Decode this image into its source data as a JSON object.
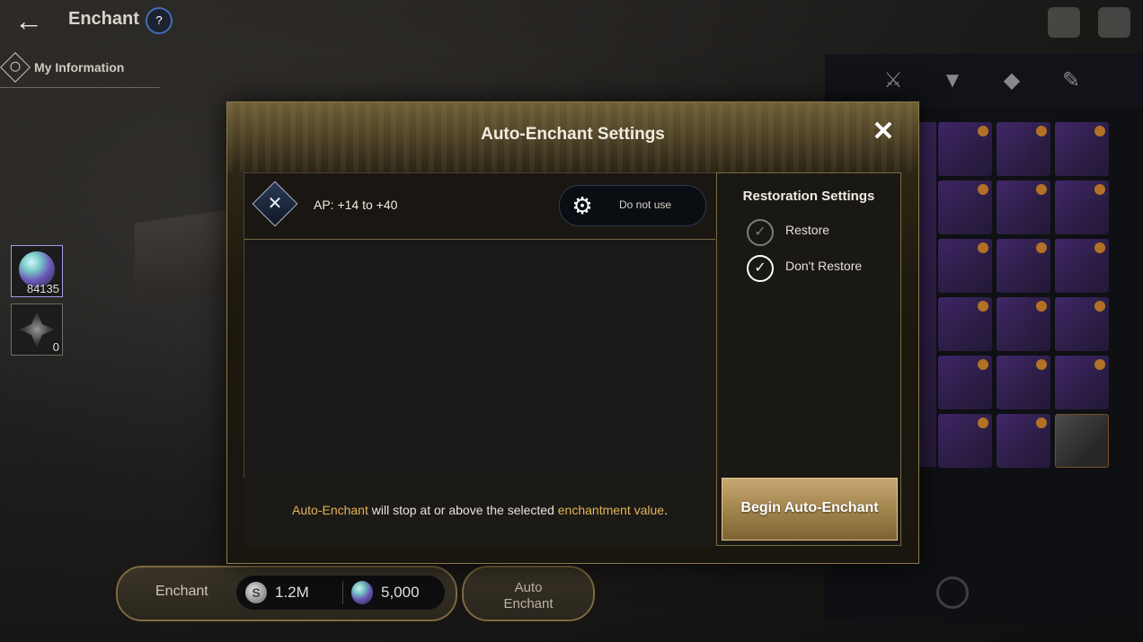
{
  "header": {
    "title": "Enchant",
    "my_information": "My Information"
  },
  "materials": [
    {
      "count": "84135",
      "icon": "gem-icon"
    },
    {
      "count": "0",
      "icon": "dark-stone-icon"
    }
  ],
  "bottom_bar": {
    "enchant_label": "Enchant",
    "silver_cost": "1.2M",
    "gem_cost": "5,000",
    "auto_enchant_label": "Auto Enchant"
  },
  "modal": {
    "title": "Auto-Enchant Settings",
    "option": {
      "label": "AP: +14 to +40",
      "select_value": "Do not use"
    },
    "notice": {
      "part1": "Auto-Enchant",
      "part2": " will stop at or above the selected ",
      "part3": "enchantment value",
      "part4": "."
    },
    "restoration": {
      "title": "Restoration Settings",
      "options": [
        {
          "label": "Restore",
          "selected": false
        },
        {
          "label": "Don't Restore",
          "selected": true
        }
      ]
    },
    "begin_button": "Begin Auto-Enchant"
  },
  "colors": {
    "gold_accent": "#e3b35a",
    "modal_border": "#8d7a47",
    "button_gold": "#c7a873"
  }
}
